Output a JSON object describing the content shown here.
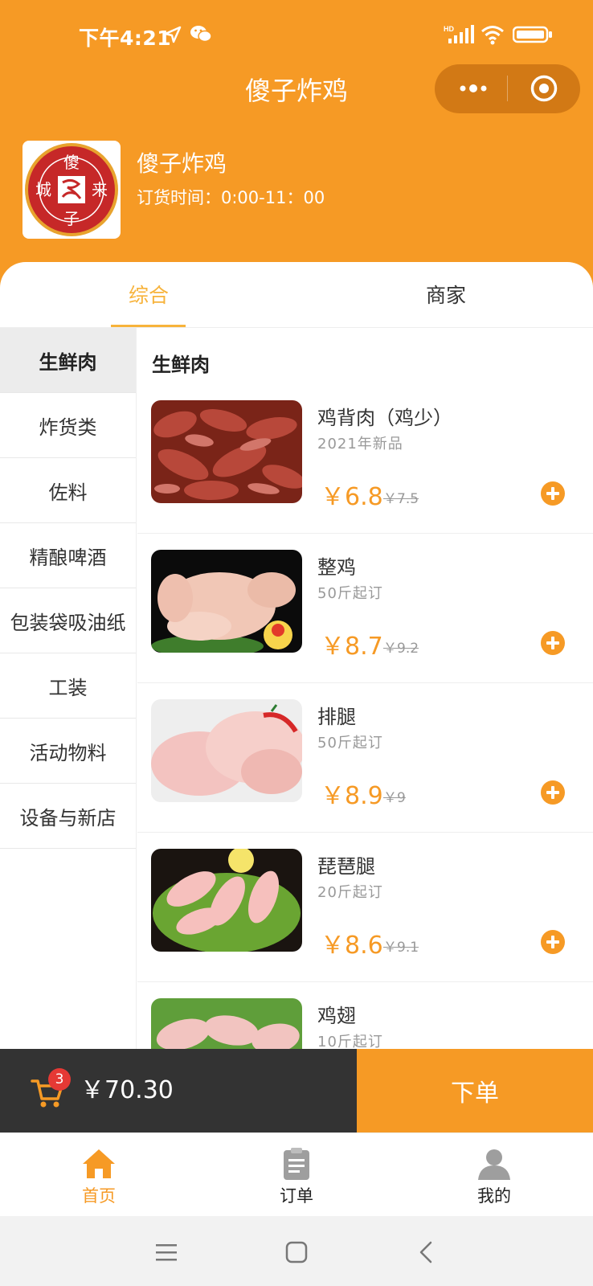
{
  "status_bar": {
    "time": "下午4:21"
  },
  "nav": {
    "title": "傻子炸鸡"
  },
  "store": {
    "name": "傻子炸鸡",
    "order_time": "订货时间：0:00-11：00",
    "logo_chars": [
      "傻",
      "城",
      "来",
      "子"
    ]
  },
  "tabs": [
    {
      "label": "综合"
    },
    {
      "label": "商家"
    }
  ],
  "sidebar": {
    "items": [
      {
        "label": "生鲜肉"
      },
      {
        "label": "炸货类"
      },
      {
        "label": "佐料"
      },
      {
        "label": "精酿啤酒"
      },
      {
        "label": "包装袋吸油纸"
      },
      {
        "label": "工装"
      },
      {
        "label": "活动物料"
      },
      {
        "label": "设备与新店"
      }
    ]
  },
  "section": {
    "title": "生鲜肉"
  },
  "products": [
    {
      "name": "鸡背肉（鸡少）",
      "sub": "2021年新品",
      "price": "￥6.8",
      "old_price": "￥7.5"
    },
    {
      "name": "整鸡",
      "sub": "50斤起订",
      "price": "￥8.7",
      "old_price": "￥9.2"
    },
    {
      "name": "排腿",
      "sub": "50斤起订",
      "price": "￥8.9",
      "old_price": "￥9"
    },
    {
      "name": "琵琶腿",
      "sub": "20斤起订",
      "price": "￥8.6",
      "old_price": "￥9.1"
    },
    {
      "name": "鸡翅",
      "sub": "10斤起订",
      "price": "",
      "old_price": ""
    }
  ],
  "cart": {
    "count": "3",
    "total": "￥70.30",
    "order_label": "下单"
  },
  "tabbar": [
    {
      "label": "首页"
    },
    {
      "label": "订单"
    },
    {
      "label": "我的"
    }
  ],
  "colors": {
    "accent": "#F69A25",
    "tab_active": "#F7B33B",
    "badge": "#E53935",
    "cart_bg": "#333333"
  }
}
